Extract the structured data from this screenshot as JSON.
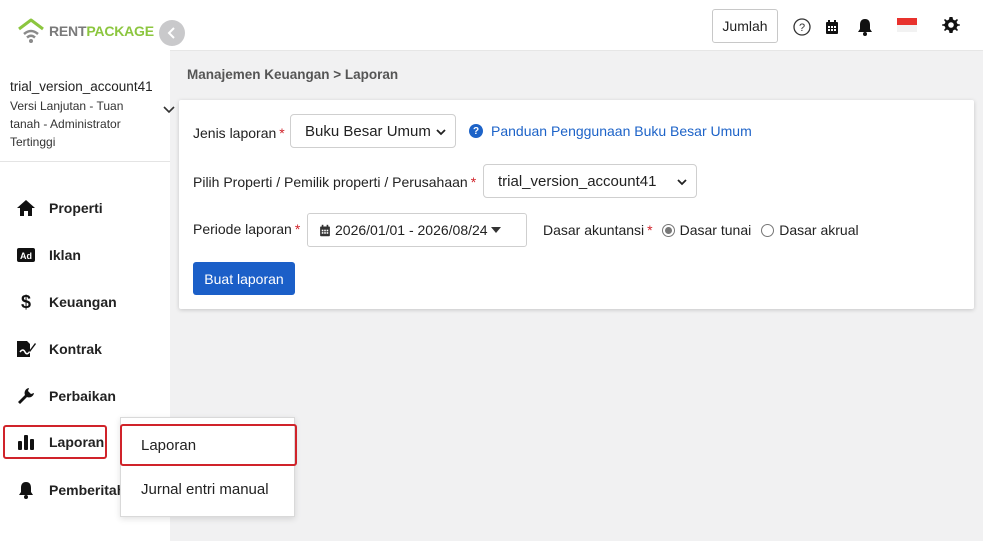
{
  "logo": {
    "part1": "RENT",
    "part2": "PACKAGE"
  },
  "account": {
    "name": "trial_version_account41",
    "subtitle": "Versi Lanjutan - Tuan tanah - Administrator Tertinggi"
  },
  "nav": {
    "items": [
      {
        "label": "Properti",
        "icon": "home-icon"
      },
      {
        "label": "Iklan",
        "icon": "ad-icon"
      },
      {
        "label": "Keuangan",
        "icon": "dollar-icon"
      },
      {
        "label": "Kontrak",
        "icon": "contract-icon"
      },
      {
        "label": "Perbaikan",
        "icon": "wrench-icon"
      },
      {
        "label": "Laporan",
        "icon": "bar-chart-icon"
      },
      {
        "label": "Pemberitah",
        "icon": "bell-icon"
      }
    ],
    "submenu": [
      {
        "label": "Laporan"
      },
      {
        "label": "Jurnal entri manual"
      }
    ]
  },
  "topbar": {
    "jumlah_label": "Jumlah",
    "icons": [
      "help-icon",
      "calendar-icon",
      "bell-icon",
      "flag-icon",
      "gear-icon"
    ]
  },
  "breadcrumb": "Manajemen Keuangan > Laporan",
  "form": {
    "report_type_label": "Jenis laporan",
    "report_type_value": "Buku Besar Umum",
    "help_link": "Panduan Penggunaan Buku Besar Umum",
    "property_label": "Pilih Properti / Pemilik properti / Perusahaan",
    "property_value": "trial_version_account41",
    "period_label": "Periode laporan",
    "period_value": "2026/01/01 - 2026/08/24",
    "basis_label": "Dasar akuntansi",
    "basis_options": [
      {
        "label": "Dasar tunai",
        "checked": true
      },
      {
        "label": "Dasar akrual",
        "checked": false
      }
    ],
    "required_mark": "*",
    "submit_label": "Buat laporan"
  },
  "colors": {
    "primary": "#1b5fc8",
    "highlight": "#d0232a",
    "brand_green": "#8cc63f"
  }
}
